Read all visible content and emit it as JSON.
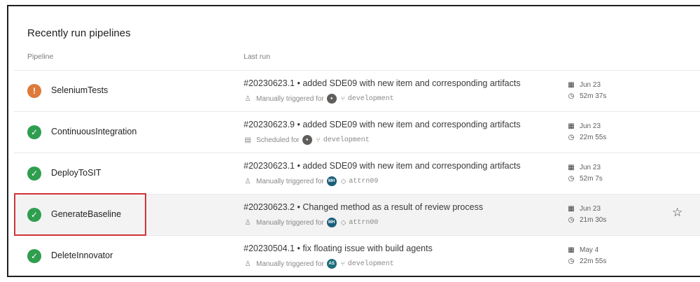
{
  "section": {
    "title": "Recently run pipelines",
    "col_pipeline": "Pipeline",
    "col_last_run": "Last run"
  },
  "rows": [
    {
      "status": "warning",
      "status_icon": "exclamation-icon",
      "name": "SeleniumTests",
      "run_title": "#20230623.1 • added SDE09 with new item and corresponding artifacts",
      "trigger_text": "Manually triggered for",
      "trigger_icon": "user-icon",
      "avatar": "person",
      "ref_type": "branch",
      "ref": "development",
      "date": "Jun 23",
      "duration": "52m 37s"
    },
    {
      "status": "success",
      "status_icon": "check-icon",
      "name": "ContinuousIntegration",
      "run_title": "#20230623.9 • added SDE09 with new item and corresponding artifacts",
      "trigger_text": "Scheduled for",
      "trigger_icon": "calendar-icon",
      "avatar": "person",
      "ref_type": "branch",
      "ref": "development",
      "date": "Jun 23",
      "duration": "22m 55s"
    },
    {
      "status": "success",
      "status_icon": "check-icon",
      "name": "DeployToSIT",
      "run_title": "#20230623.1 • added SDE09 with new item and corresponding artifacts",
      "trigger_text": "Manually triggered for",
      "trigger_icon": "user-icon",
      "avatar": "MH",
      "ref_type": "tag",
      "ref": "attrn09",
      "date": "Jun 23",
      "duration": "52m 7s"
    },
    {
      "status": "success",
      "status_icon": "check-icon",
      "name": "GenerateBaseline",
      "run_title": "#20230623.2 • Changed method as a result of review process",
      "trigger_text": "Manually triggered for",
      "trigger_icon": "user-icon",
      "avatar": "MH",
      "ref_type": "tag",
      "ref": "attrn00",
      "date": "Jun 23",
      "duration": "21m 30s"
    },
    {
      "status": "success",
      "status_icon": "check-icon",
      "name": "DeleteInnovator",
      "run_title": "#20230504.1 • fix floating issue with build agents",
      "trigger_text": "Manually triggered for",
      "trigger_icon": "user-icon",
      "avatar": "AS",
      "ref_type": "branch",
      "ref": "development",
      "date": "May 4",
      "duration": "22m 55s"
    }
  ],
  "highlight_row": "GenerateBaseline",
  "colors": {
    "success": "#2f9e4f",
    "warning": "#de7a3b",
    "highlight_border": "#d13438"
  }
}
